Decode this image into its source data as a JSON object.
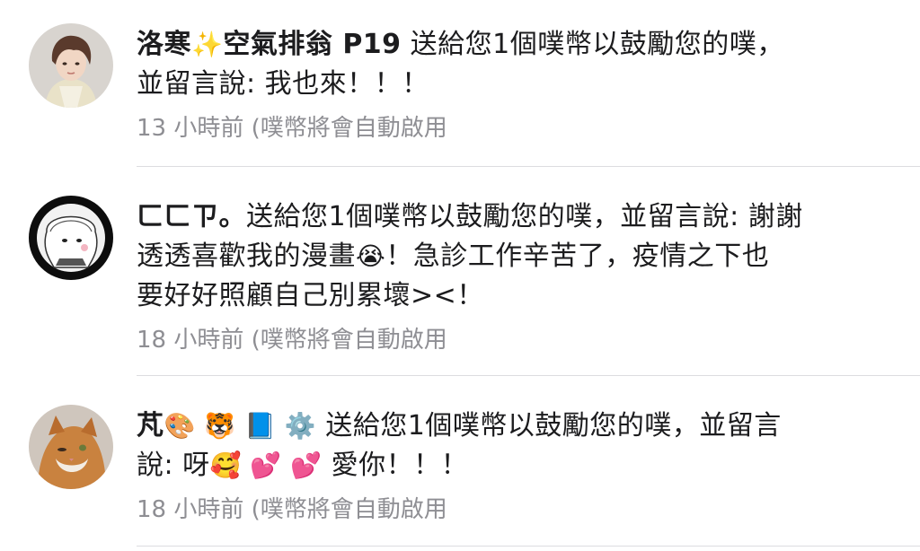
{
  "gifts": [
    {
      "user": "洛寒",
      "user_suffix": "空氣排翁 P19",
      "sparkle_emoji": "✨",
      "message_prefix": "送給您1個噗幣以鼓勵您的噗，",
      "message_body": "並留言說: 我也來！！！",
      "time": "13 小時前",
      "status": "(噗幣將會自動啟用"
    },
    {
      "user": "ㄈㄈㄗ。",
      "message_line1": "送給您1個噗幣以鼓勵您的噗，並留言說: 謝謝",
      "message_line2a": "透透喜歡我的漫畫",
      "cry_emoji": "😭",
      "message_line2b": "！急診工作辛苦了，疫情之下也",
      "message_line3": "要好好照顧自己別累壞><！",
      "time": "18 小時前",
      "status": "(噗幣將會自動啟用"
    },
    {
      "user": "芃",
      "emojis_after_name": "🎨 🐯 📘 ⚙️",
      "message_line1": "送給您1個噗幣以鼓勵您的噗，並留言",
      "message_line2a": "說: 呀",
      "emojis_in_message": "🥰 💕 💕",
      "message_line2b": "愛你！！！",
      "time": "18 小時前",
      "status": "(噗幣將會自動啟用"
    }
  ]
}
